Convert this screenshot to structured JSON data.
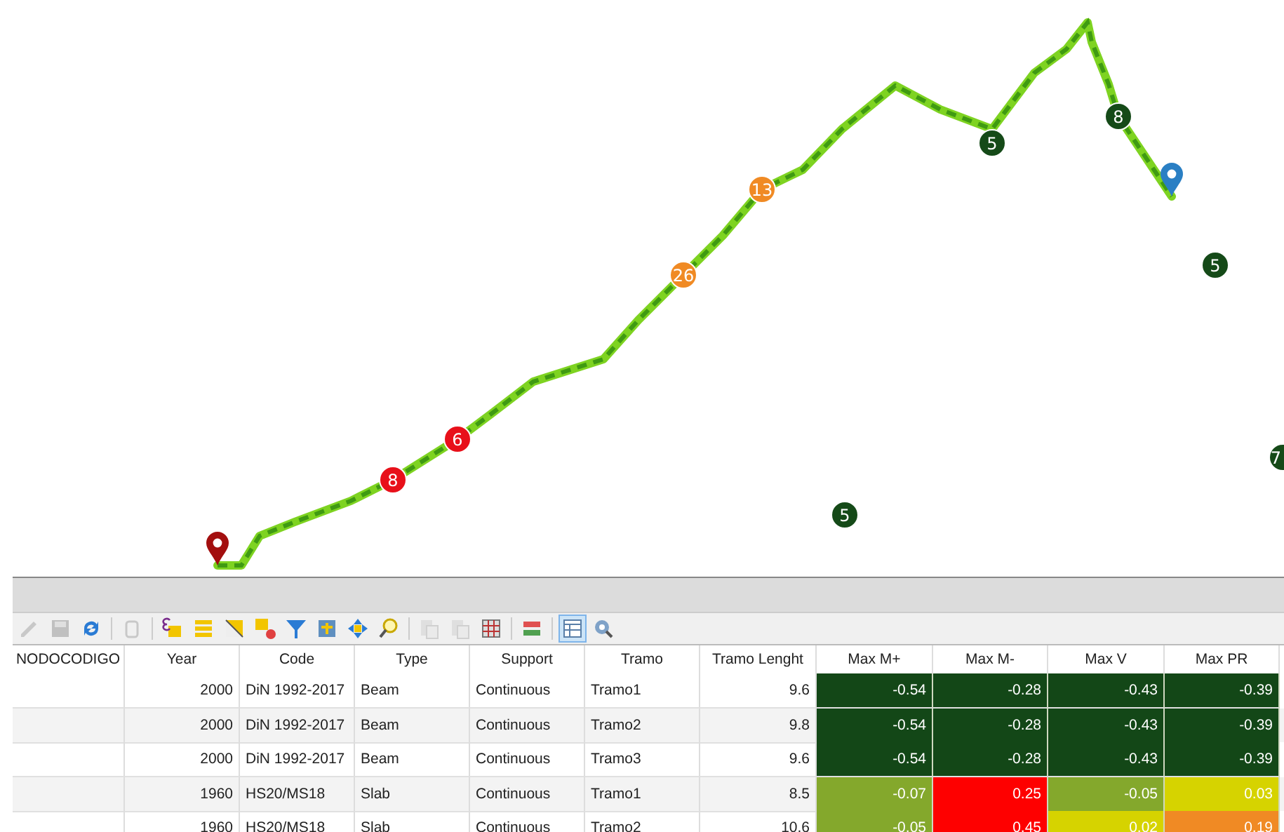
{
  "map": {
    "markers": [
      {
        "kind": "start-pin",
        "color": "#a30f0f"
      },
      {
        "kind": "end-pin",
        "color": "#2a7fc4"
      },
      {
        "kind": "cluster",
        "label": "8",
        "color": "#e8101a"
      },
      {
        "kind": "cluster",
        "label": "6",
        "color": "#e8101a"
      },
      {
        "kind": "cluster",
        "label": "26",
        "color": "#f08a24"
      },
      {
        "kind": "cluster",
        "label": "13",
        "color": "#f08a24"
      },
      {
        "kind": "cluster",
        "label": "5",
        "color": "#154a18"
      },
      {
        "kind": "cluster",
        "label": "8",
        "color": "#154a18"
      },
      {
        "kind": "cluster",
        "label": "5",
        "color": "#154a18"
      },
      {
        "kind": "cluster",
        "label": "5",
        "color": "#154a18"
      },
      {
        "kind": "cluster",
        "label": "7",
        "color": "#154a18"
      }
    ]
  },
  "toolbar": [
    {
      "kind": "edit",
      "disabled": true,
      "selected": false
    },
    {
      "kind": "save",
      "disabled": true,
      "selected": false
    },
    {
      "kind": "reload",
      "disabled": false,
      "selected": false
    },
    {
      "kind": "sep"
    },
    {
      "kind": "delete",
      "disabled": true,
      "selected": false
    },
    {
      "kind": "sep"
    },
    {
      "kind": "expression",
      "disabled": false,
      "selected": false
    },
    {
      "kind": "select-all",
      "disabled": false,
      "selected": false
    },
    {
      "kind": "invert",
      "disabled": false,
      "selected": false
    },
    {
      "kind": "deselect",
      "disabled": false,
      "selected": false
    },
    {
      "kind": "filter",
      "disabled": false,
      "selected": false
    },
    {
      "kind": "move-top",
      "disabled": false,
      "selected": false
    },
    {
      "kind": "pan",
      "disabled": false,
      "selected": false
    },
    {
      "kind": "zoom",
      "disabled": false,
      "selected": false
    },
    {
      "kind": "sep"
    },
    {
      "kind": "copy",
      "disabled": true,
      "selected": false
    },
    {
      "kind": "paste",
      "disabled": true,
      "selected": false
    },
    {
      "kind": "field-calc",
      "disabled": false,
      "selected": false
    },
    {
      "kind": "sep"
    },
    {
      "kind": "conditional",
      "disabled": false,
      "selected": false
    },
    {
      "kind": "sep"
    },
    {
      "kind": "table-view",
      "disabled": false,
      "selected": true
    },
    {
      "kind": "actions",
      "disabled": false,
      "selected": false
    }
  ],
  "table": {
    "columns": [
      "NODOCODIGO",
      "Year",
      "Code",
      "Type",
      "Support",
      "Tramo",
      "Tramo Lenght",
      "Max M+",
      "Max M-",
      "Max V",
      "Max PR"
    ],
    "rows": [
      [
        {
          "text": ""
        },
        {
          "text": "2000"
        },
        {
          "text": "DiN 1992-2017"
        },
        {
          "text": "Beam"
        },
        {
          "text": "Continuous"
        },
        {
          "text": "Tramo1"
        },
        {
          "text": "9.6"
        },
        {
          "text": "-0.54",
          "color": "#134717"
        },
        {
          "text": "-0.28",
          "color": "#134717"
        },
        {
          "text": "-0.43",
          "color": "#134717"
        },
        {
          "text": "-0.39",
          "color": "#134717"
        }
      ],
      [
        {
          "text": ""
        },
        {
          "text": "2000"
        },
        {
          "text": "DiN 1992-2017"
        },
        {
          "text": "Beam"
        },
        {
          "text": "Continuous"
        },
        {
          "text": "Tramo2"
        },
        {
          "text": "9.8"
        },
        {
          "text": "-0.54",
          "color": "#134717"
        },
        {
          "text": "-0.28",
          "color": "#134717"
        },
        {
          "text": "-0.43",
          "color": "#134717"
        },
        {
          "text": "-0.39",
          "color": "#134717"
        }
      ],
      [
        {
          "text": ""
        },
        {
          "text": "2000"
        },
        {
          "text": "DiN 1992-2017"
        },
        {
          "text": "Beam"
        },
        {
          "text": "Continuous"
        },
        {
          "text": "Tramo3"
        },
        {
          "text": "9.6"
        },
        {
          "text": "-0.54",
          "color": "#134717"
        },
        {
          "text": "-0.28",
          "color": "#134717"
        },
        {
          "text": "-0.43",
          "color": "#134717"
        },
        {
          "text": "-0.39",
          "color": "#134717"
        }
      ],
      [
        {
          "text": ""
        },
        {
          "text": "1960"
        },
        {
          "text": "HS20/MS18"
        },
        {
          "text": "Slab"
        },
        {
          "text": "Continuous"
        },
        {
          "text": "Tramo1"
        },
        {
          "text": "8.5"
        },
        {
          "text": "-0.07",
          "color": "#84a82c"
        },
        {
          "text": "0.25",
          "color": "#fe0000"
        },
        {
          "text": "-0.05",
          "color": "#84a82c"
        },
        {
          "text": "0.03",
          "color": "#d6d300"
        }
      ],
      [
        {
          "text": ""
        },
        {
          "text": "1960"
        },
        {
          "text": "HS20/MS18"
        },
        {
          "text": "Slab"
        },
        {
          "text": "Continuous"
        },
        {
          "text": "Tramo2"
        },
        {
          "text": "10.6"
        },
        {
          "text": "-0.05",
          "color": "#84a82c"
        },
        {
          "text": "0.45",
          "color": "#fe0000"
        },
        {
          "text": "0.02",
          "color": "#d6d300"
        },
        {
          "text": "0.19",
          "color": "#f08a24"
        }
      ]
    ]
  }
}
